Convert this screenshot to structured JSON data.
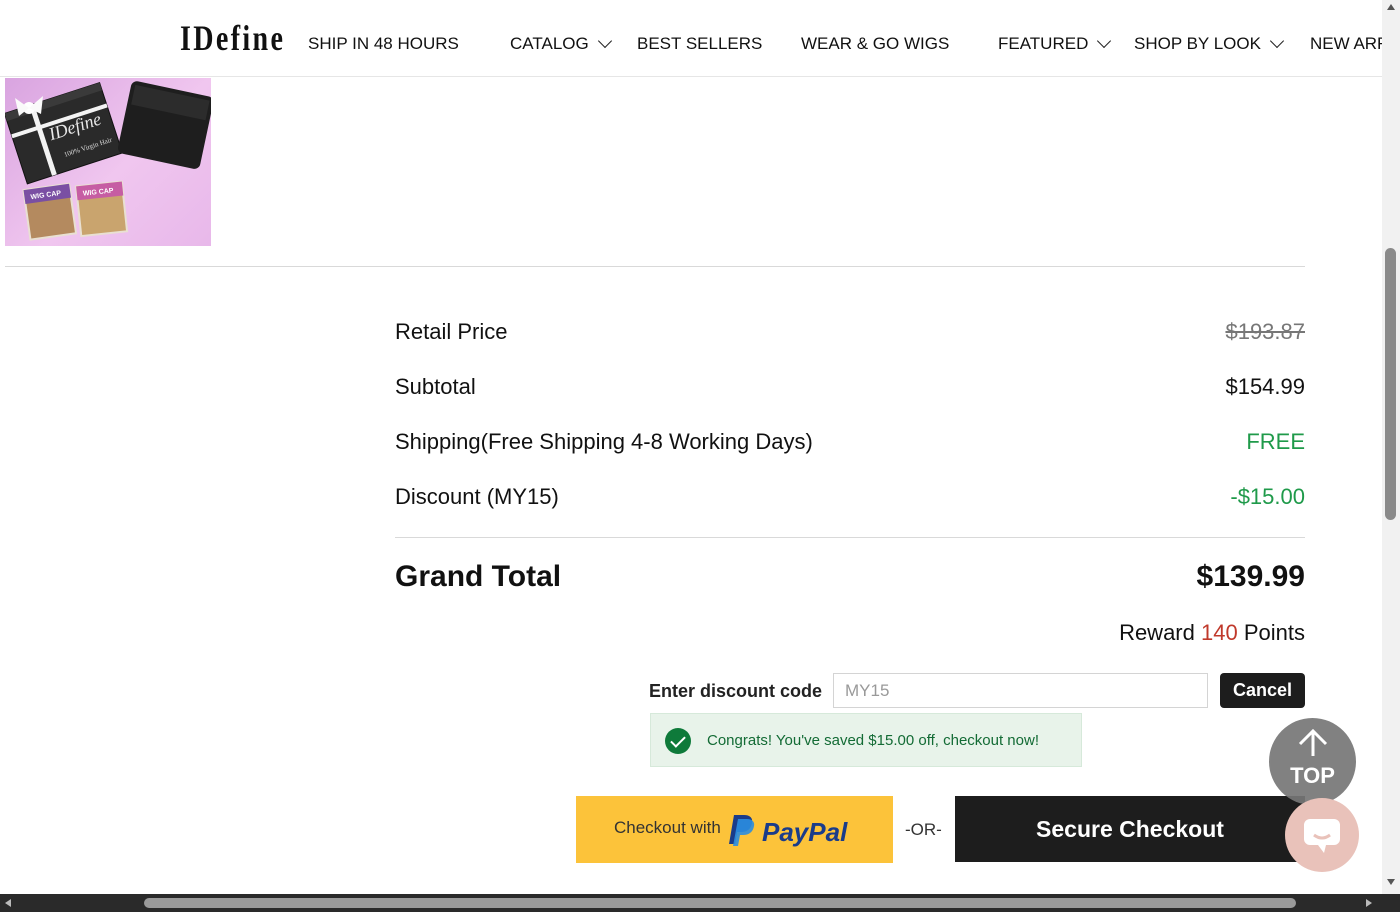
{
  "brand": {
    "logo_text": "IDefine"
  },
  "nav": {
    "items": [
      {
        "label": "SHIP IN 48 HOURS",
        "dropdown": false
      },
      {
        "label": "CATALOG",
        "dropdown": true
      },
      {
        "label": "BEST SELLERS",
        "dropdown": false
      },
      {
        "label": "WEAR & GO WIGS",
        "dropdown": false
      },
      {
        "label": "FEATURED",
        "dropdown": true
      },
      {
        "label": "SHOP BY LOOK",
        "dropdown": true
      },
      {
        "label": "NEW ARR",
        "dropdown": false
      }
    ]
  },
  "product": {
    "image_box_text": "IDefine",
    "image_box_subtext": "100% Virgin Hair",
    "image_cap_text": "WIG CAP"
  },
  "summary": {
    "retail_price": {
      "label": "Retail Price",
      "value": "$193.87"
    },
    "subtotal": {
      "label": "Subtotal",
      "value": "$154.99"
    },
    "shipping": {
      "label": "Shipping(Free Shipping 4-8 Working Days)",
      "value": "FREE"
    },
    "discount": {
      "label": "Discount (MY15)",
      "value": "-$15.00"
    },
    "grand_total": {
      "label": "Grand Total",
      "value": "$139.99"
    },
    "reward": {
      "prefix": "Reward",
      "points": "140",
      "suffix": "Points"
    }
  },
  "discount_code": {
    "label": "Enter discount code",
    "placeholder": "MY15",
    "value": "",
    "cancel_label": "Cancel",
    "success_message": "Congrats! You've saved $15.00 off, checkout now!"
  },
  "checkout": {
    "paypal_prefix": "Checkout with",
    "paypal_brand": "PayPal",
    "or_text": "-OR-",
    "secure_label": "Secure Checkout"
  },
  "floating": {
    "top_label": "TOP",
    "top_icon": "arrow-up-icon",
    "chat_icon": "chat-icon"
  },
  "colors": {
    "accent_green": "#1f9a4a",
    "reward_red": "#c0392b",
    "paypal_yellow": "#fcc33a",
    "dark_button": "#1d1d1d",
    "success_bg": "#e8f3ea"
  }
}
